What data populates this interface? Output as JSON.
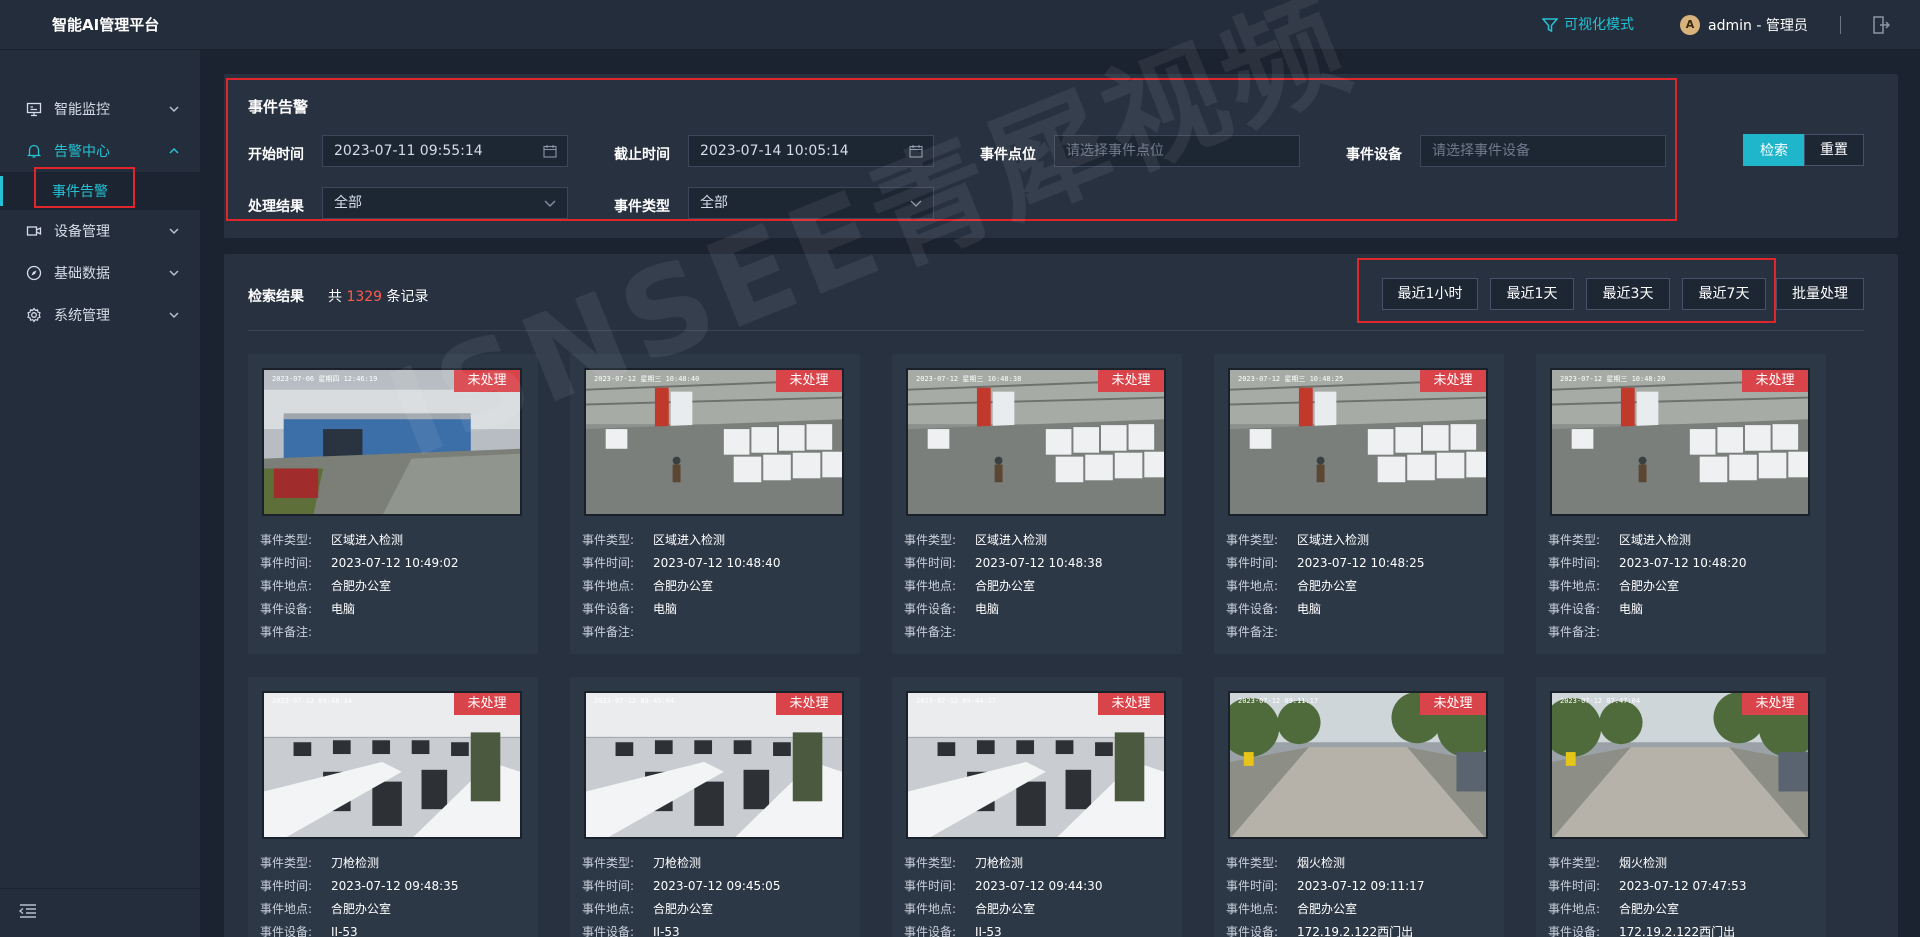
{
  "app": {
    "title": "智能AI管理平台"
  },
  "topbar": {
    "vis_mode": "可视化模式",
    "avatar_letter": "A",
    "user": "admin - 管理员"
  },
  "sidebar": {
    "items": [
      {
        "label": "智能监控",
        "icon": "monitor-icon",
        "expanded": false
      },
      {
        "label": "告警中心",
        "icon": "bell-icon",
        "expanded": true
      },
      {
        "label": "设备管理",
        "icon": "camera-icon",
        "expanded": false
      },
      {
        "label": "基础数据",
        "icon": "compass-icon",
        "expanded": false
      },
      {
        "label": "系统管理",
        "icon": "gear-icon",
        "expanded": false
      }
    ],
    "sub_item": "事件告警"
  },
  "filter": {
    "title": "事件告警",
    "start_label": "开始时间",
    "start_value": "2023-07-11 09:55:14",
    "end_label": "截止时间",
    "end_value": "2023-07-14 10:05:14",
    "point_label": "事件点位",
    "point_placeholder": "请选择事件点位",
    "device_label": "事件设备",
    "device_placeholder": "请选择事件设备",
    "result_label": "处理结果",
    "result_value": "全部",
    "type_label": "事件类型",
    "type_value": "全部",
    "search_btn": "检索",
    "reset_btn": "重置"
  },
  "results": {
    "title": "检索结果",
    "count_prefix": "共",
    "count": "1329",
    "count_suffix": "条记录",
    "quick": [
      "最近1小时",
      "最近1天",
      "最近3天",
      "最近7天"
    ],
    "batch_btn": "批量处理"
  },
  "card_labels": {
    "type": "事件类型:",
    "time": "事件时间:",
    "place": "事件地点:",
    "device": "事件设备:",
    "note": "事件备注:"
  },
  "watermark": "ISNSEE青犀视频",
  "cards": [
    {
      "badge": "未处理",
      "ts": "2023-07-06 星期四 12:46:19",
      "scene": "outdoor",
      "type": "区域进入检测",
      "time": "2023-07-12 10:49:02",
      "place": "合肥办公室",
      "device": "电脑",
      "note": ""
    },
    {
      "badge": "未处理",
      "ts": "2023-07-12 星期三 10:48:40",
      "scene": "warehouse",
      "type": "区域进入检测",
      "time": "2023-07-12 10:48:40",
      "place": "合肥办公室",
      "device": "电脑",
      "note": ""
    },
    {
      "badge": "未处理",
      "ts": "2023-07-12 星期三 10:48:38",
      "scene": "warehouse",
      "type": "区域进入检测",
      "time": "2023-07-12 10:48:38",
      "place": "合肥办公室",
      "device": "电脑",
      "note": ""
    },
    {
      "badge": "未处理",
      "ts": "2023-07-12 星期三 10:48:25",
      "scene": "warehouse",
      "type": "区域进入检测",
      "time": "2023-07-12 10:48:25",
      "place": "合肥办公室",
      "device": "电脑",
      "note": ""
    },
    {
      "badge": "未处理",
      "ts": "2023-07-12 星期三 10:48:20",
      "scene": "warehouse",
      "type": "区域进入检测",
      "time": "2023-07-12 10:48:20",
      "place": "合肥办公室",
      "device": "电脑",
      "note": ""
    },
    {
      "badge": "未处理",
      "ts": "2023-07-12 09:48:34",
      "scene": "office",
      "type": "刀枪检测",
      "time": "2023-07-12 09:48:35",
      "place": "合肥办公室",
      "device": "II-53",
      "note": ""
    },
    {
      "badge": "未处理",
      "ts": "2023-07-12 09:45:04",
      "scene": "office",
      "type": "刀枪检测",
      "time": "2023-07-12 09:45:05",
      "place": "合肥办公室",
      "device": "II-53",
      "note": ""
    },
    {
      "badge": "未处理",
      "ts": "2023-07-12 09:44:27",
      "scene": "office",
      "type": "刀枪检测",
      "time": "2023-07-12 09:44:30",
      "place": "合肥办公室",
      "device": "II-53",
      "note": ""
    },
    {
      "badge": "未处理",
      "ts": "2023-07-12 09:11:17",
      "scene": "street",
      "type": "烟火检测",
      "time": "2023-07-12 09:11:17",
      "place": "合肥办公室",
      "device": "172.19.2.122西门出",
      "note": ""
    },
    {
      "badge": "未处理",
      "ts": "2023-07-12 07:47:04",
      "scene": "street",
      "type": "烟火检测",
      "time": "2023-07-12 07:47:53",
      "place": "合肥办公室",
      "device": "172.19.2.122西门出",
      "note": ""
    }
  ]
}
